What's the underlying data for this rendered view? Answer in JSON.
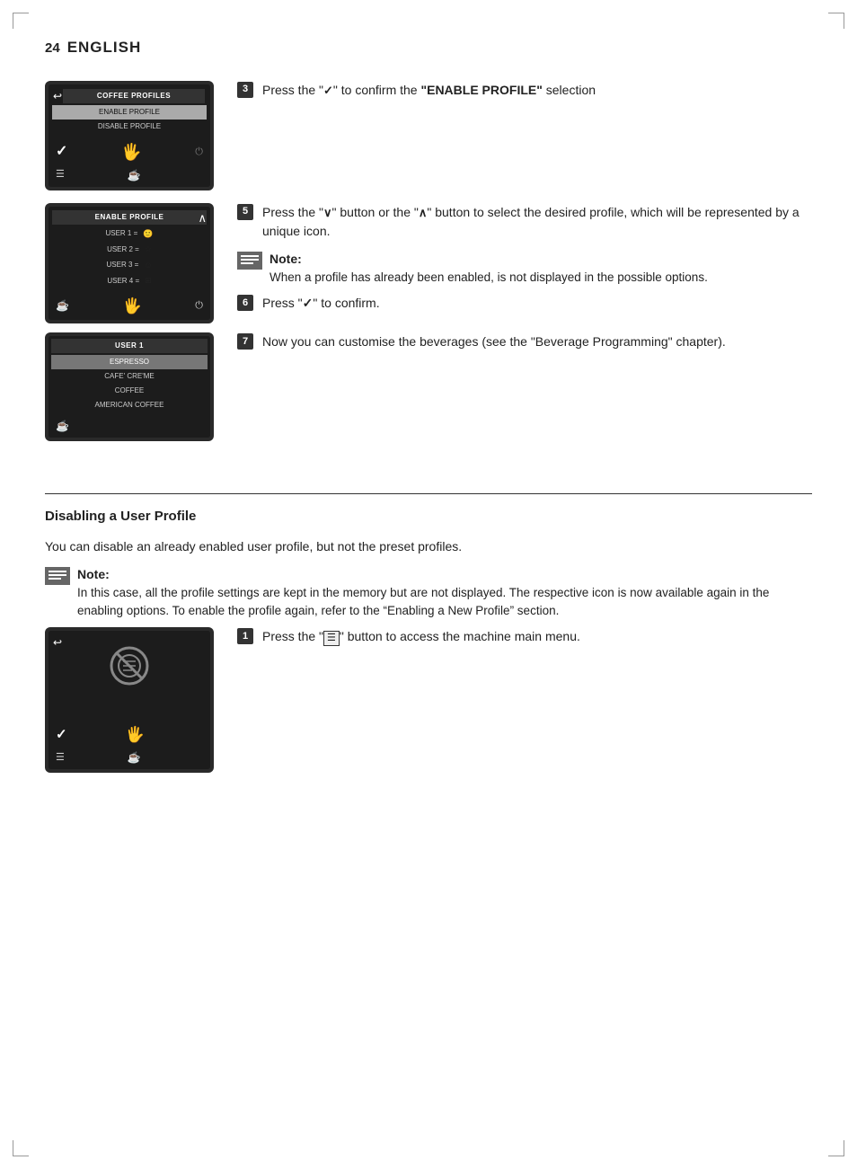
{
  "header": {
    "page_number": "24",
    "language": "ENGLISH"
  },
  "steps": [
    {
      "id": "step3",
      "number": "3",
      "text": "Press the “✓” to confirm the ",
      "bold_text": "“ENABLE PROFILE”",
      "text_after": " selection"
    },
    {
      "id": "step5",
      "number": "5",
      "text": "Press the “∨” button or the “∧” button to select the desired profile, which will be represented by a unique icon."
    },
    {
      "id": "step5_note_title",
      "text": "Note:"
    },
    {
      "id": "step5_note_body",
      "text": "When a profile has already been enabled, is not displayed in the possible options."
    },
    {
      "id": "step6",
      "number": "6",
      "text": "Press “✓” to confirm."
    },
    {
      "id": "step7",
      "number": "7",
      "text": "Now you can customise the beverages (see the “Beverage Programming” chapter)."
    }
  ],
  "screen1": {
    "title": "COFFEE PROFILES",
    "items": [
      {
        "label": "ENABLE PROFILE",
        "selected": true
      },
      {
        "label": "DISABLE PROFILE",
        "selected": false
      }
    ]
  },
  "screen2": {
    "title": "ENABLE PROFILE",
    "items": [
      {
        "label": "USER 1 =",
        "icon": "🙂"
      },
      {
        "label": "USER 2 =",
        "icon": "☆"
      },
      {
        "label": "USER 3 =",
        "icon": "☺"
      },
      {
        "label": "USER 4 =",
        "icon": "⊞"
      }
    ]
  },
  "screen3": {
    "title": "USER 1",
    "items": [
      {
        "label": "ESPRESSO"
      },
      {
        "label": "CAFE' CRE'ME"
      },
      {
        "label": "COFFEE"
      },
      {
        "label": "AMERICAN COFFEE"
      }
    ]
  },
  "disabling": {
    "section_title": "Disabling a User Profile",
    "body_text": "You can disable an already enabled user profile, but not the preset profiles.",
    "note_title": "Note:",
    "note_body": "In this case, all the profile settings are kept in the memory but are not displayed. The respective icon is now available again in the enabling options. To enable the profile again, refer to the “Enabling a New Profile” section."
  },
  "step1_disabling": {
    "number": "1",
    "text": "Press the “",
    "icon_label": "menu-icon",
    "text_after": "” button to access the machine main menu."
  }
}
